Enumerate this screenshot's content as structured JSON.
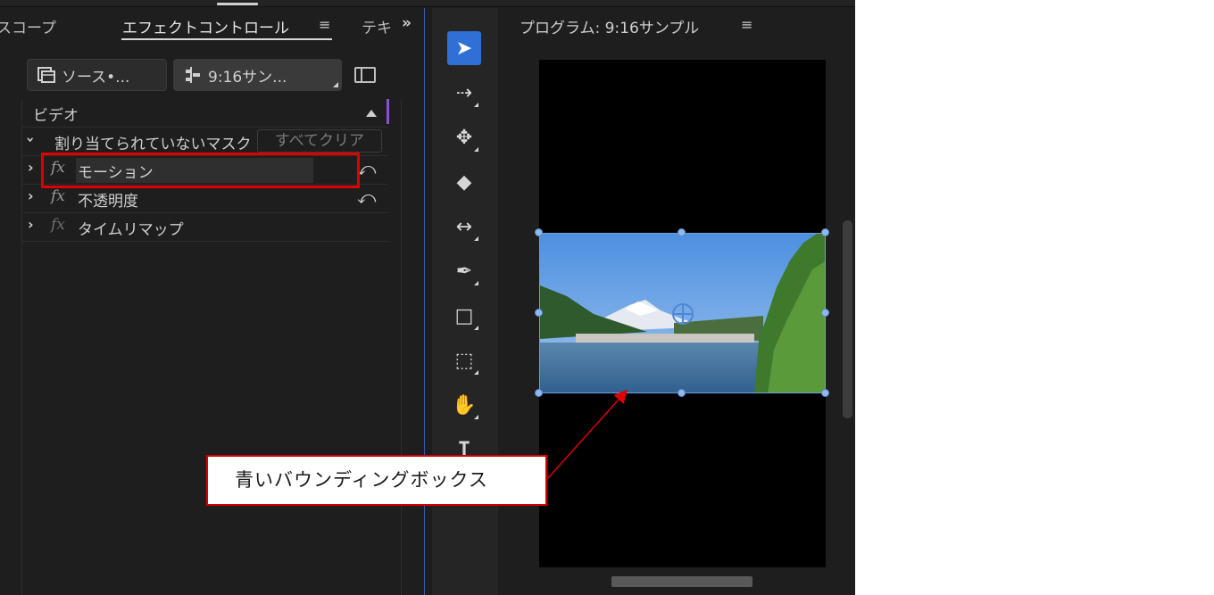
{
  "effects_panel": {
    "tabs": {
      "scopes": "スコープ",
      "effect_controls": "エフェクトコントロール",
      "menu_symbol": "≡",
      "next_truncated": "テキ",
      "overflow": "»"
    },
    "source_button": "ソース•...",
    "sequence_button": "9:16サン...",
    "section_header": "ビデオ",
    "mask_row": {
      "label": "割り当てられていないマスク",
      "clear_button": "すべてクリア"
    },
    "effects": [
      {
        "fx": "fx",
        "name": "モーション",
        "reset": "⤺"
      },
      {
        "fx": "fx",
        "name": "不透明度",
        "reset": "⤺"
      },
      {
        "fx": "fx",
        "name": "タイムリマップ"
      }
    ],
    "chevron_right": "›",
    "chevron_down": "⌄"
  },
  "tools": [
    {
      "name": "selection-tool",
      "glyph": "➤",
      "active": true
    },
    {
      "name": "track-select-forward-tool",
      "glyph": "⇢"
    },
    {
      "name": "ripple-edit-tool",
      "glyph": "✥"
    },
    {
      "name": "razor-tool",
      "glyph": "◆"
    },
    {
      "name": "slip-tool",
      "glyph": "↔"
    },
    {
      "name": "pen-tool",
      "glyph": "✒"
    },
    {
      "name": "rectangle-tool",
      "glyph": "□"
    },
    {
      "name": "remix-tool",
      "glyph": "⬚"
    },
    {
      "name": "hand-tool",
      "glyph": "✋"
    },
    {
      "name": "type-tool",
      "glyph": "T"
    }
  ],
  "program_monitor": {
    "title": "プログラム: 9:16サンプル",
    "menu_symbol": "≡"
  },
  "annotation": {
    "callout_text": "青いバウンディングボックス",
    "highlight_color": "#e00000"
  },
  "colors": {
    "accent_blue": "#2f6fd6",
    "bounding_box": "#6fa0e0"
  }
}
